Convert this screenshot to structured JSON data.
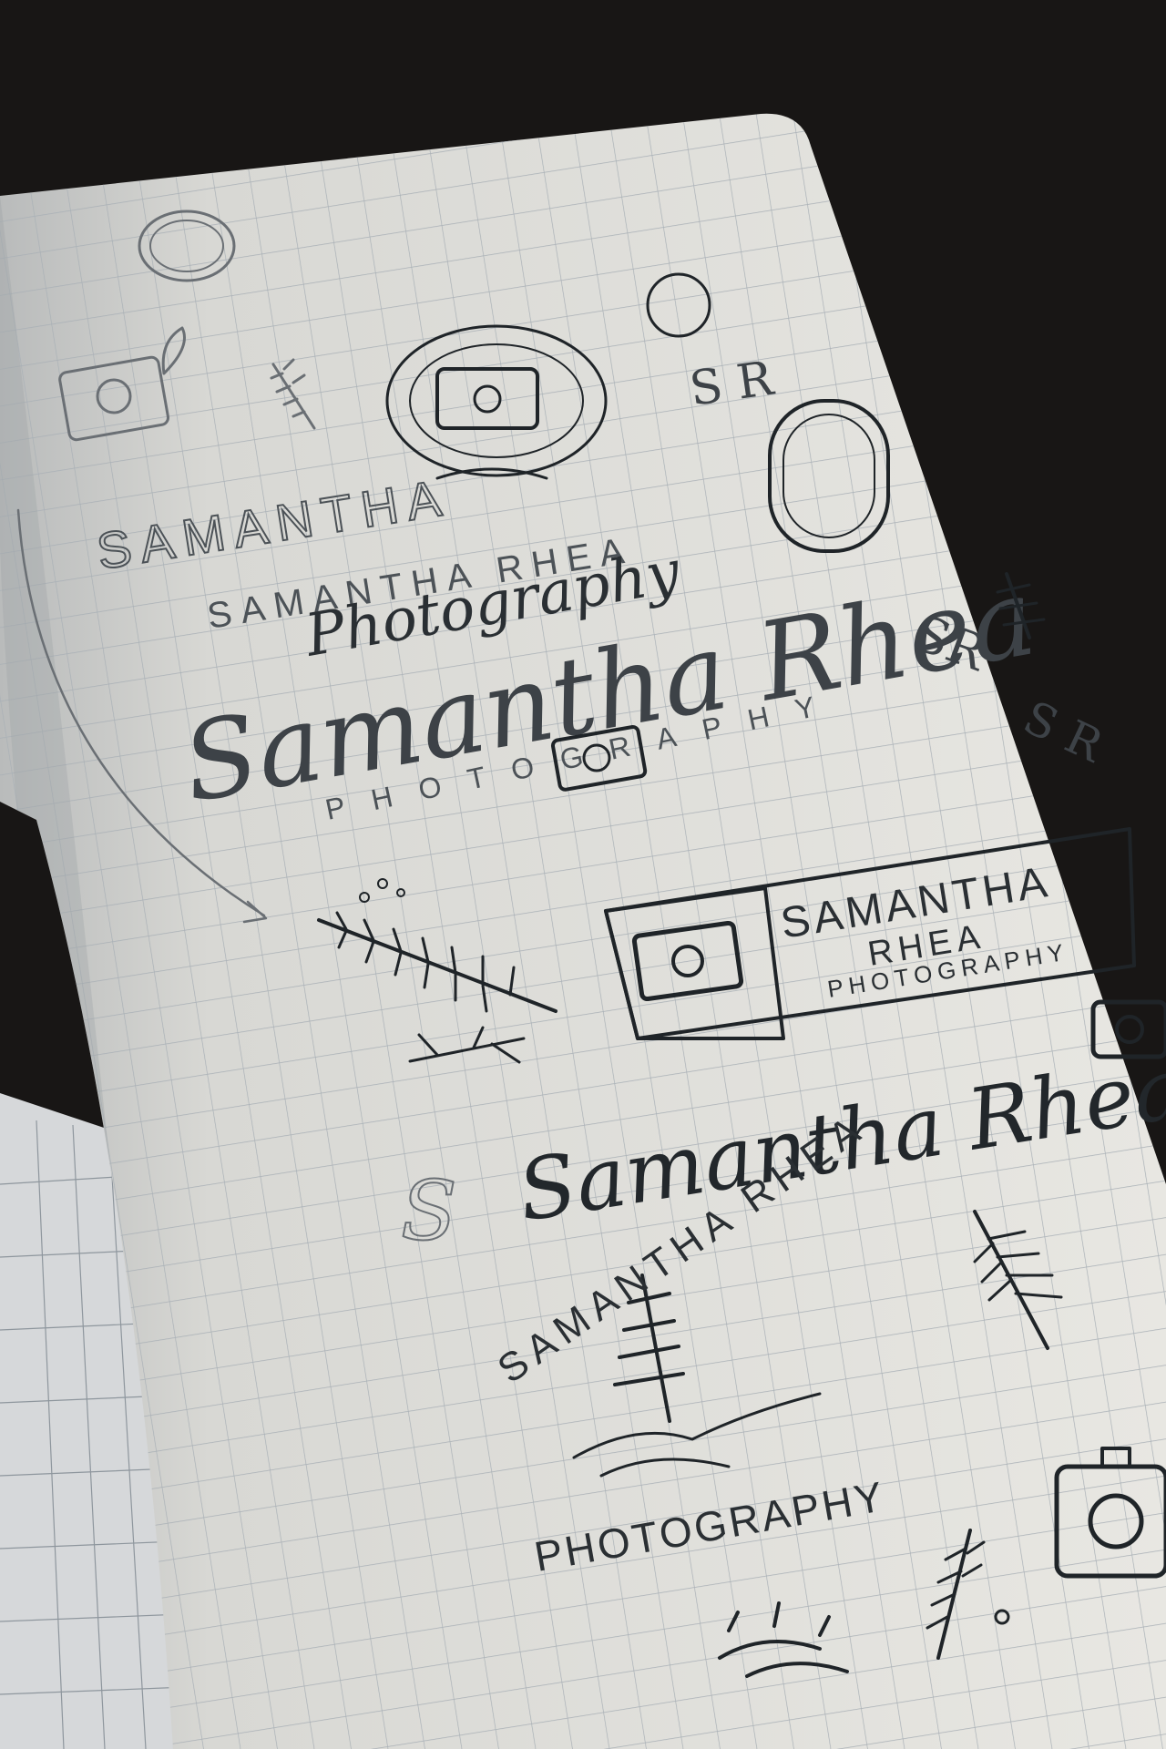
{
  "photo": {
    "subject": "sketchbook",
    "colors": {
      "background": "#181615",
      "page": "#e4e3de",
      "page_shadow": "#b9bbbb",
      "grid": "#a9b0b6",
      "ink": "#1f2428",
      "pencil": "#6a6f74"
    },
    "sketch_text": {
      "samantha_caps": "SAMANTHA",
      "samantha_rhea_caps": "SAMANTHA RHEA",
      "photography_script": "Photography",
      "samantha_rhea_script_large": "Samantha Rhea",
      "photography_spaced": "PHOTOGRAPHY",
      "box_samantha": "SAMANTHA",
      "box_rhea": "RHEA",
      "box_photography": "PHOTOGRAPHY",
      "samantha_rhea_script_mid": "Samantha Rhea",
      "samantha_rhea_arc": "SAMANTHA RHEA",
      "photography_bottom": "PHOTOGRAPHY",
      "monogram_a": "S R",
      "monogram_b": "SR",
      "monogram_c": "S R",
      "letter_s": "S"
    }
  }
}
